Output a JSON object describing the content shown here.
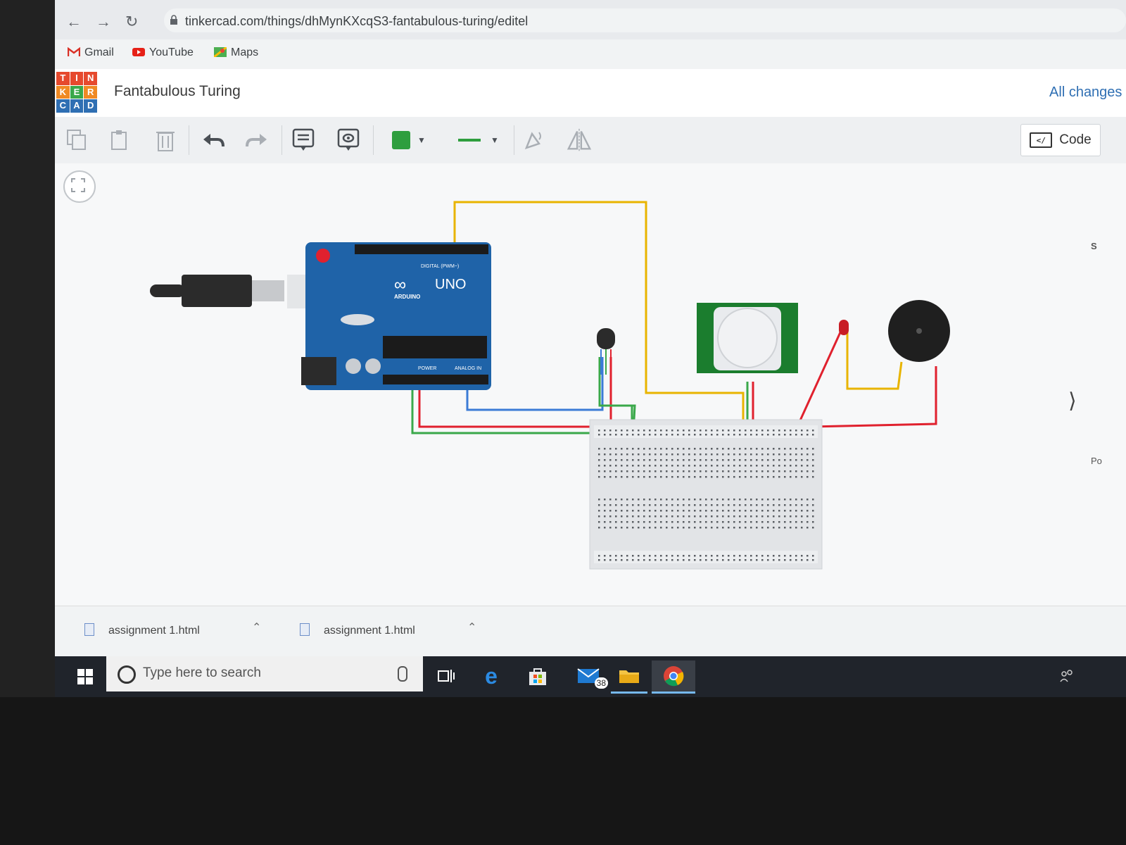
{
  "browser": {
    "url": "tinkercad.com/things/dhMynKXcqS3-fantabulous-turing/editel",
    "bookmarks": [
      {
        "label": "Gmail",
        "icon": "gmail-icon"
      },
      {
        "label": "YouTube",
        "icon": "youtube-icon"
      },
      {
        "label": "Maps",
        "icon": "maps-icon"
      }
    ]
  },
  "app": {
    "logo_letters": [
      "T",
      "I",
      "N",
      "K",
      "E",
      "R",
      "C",
      "A",
      "D"
    ],
    "project_title": "Fantabulous Turing",
    "save_status": "All changes s",
    "code_button": "Code"
  },
  "toolbar": {
    "fill_color": "#2e9e3e",
    "tools": [
      "copy-icon",
      "paste-icon",
      "delete-icon",
      "undo-icon",
      "redo-icon",
      "notes-icon",
      "annotate-icon",
      "color-picker",
      "wire-type-picker",
      "rotate-icon",
      "flip-icon"
    ]
  },
  "circuit": {
    "board": {
      "name": "UNO",
      "brand": "ARDUINO",
      "digital_label": "DIGITAL (PWM~)",
      "power_label": "POWER",
      "analog_label": "ANALOG IN"
    },
    "components": [
      "arduino-uno",
      "usb-cable",
      "temperature-sensor",
      "pir-sensor",
      "red-led",
      "piezo-buzzer",
      "breadboard"
    ],
    "wire_colors": {
      "yellow": "#e8b400",
      "blue": "#3b7bd6",
      "red": "#e0212e",
      "green": "#3aa84a"
    }
  },
  "side": {
    "partial_label": "Po",
    "partial_char": "S"
  },
  "downloads": [
    {
      "name": "assignment 1.html"
    },
    {
      "name": "assignment 1.html"
    }
  ],
  "taskbar": {
    "search_placeholder": "Type here to search",
    "mail_badge": "38"
  }
}
